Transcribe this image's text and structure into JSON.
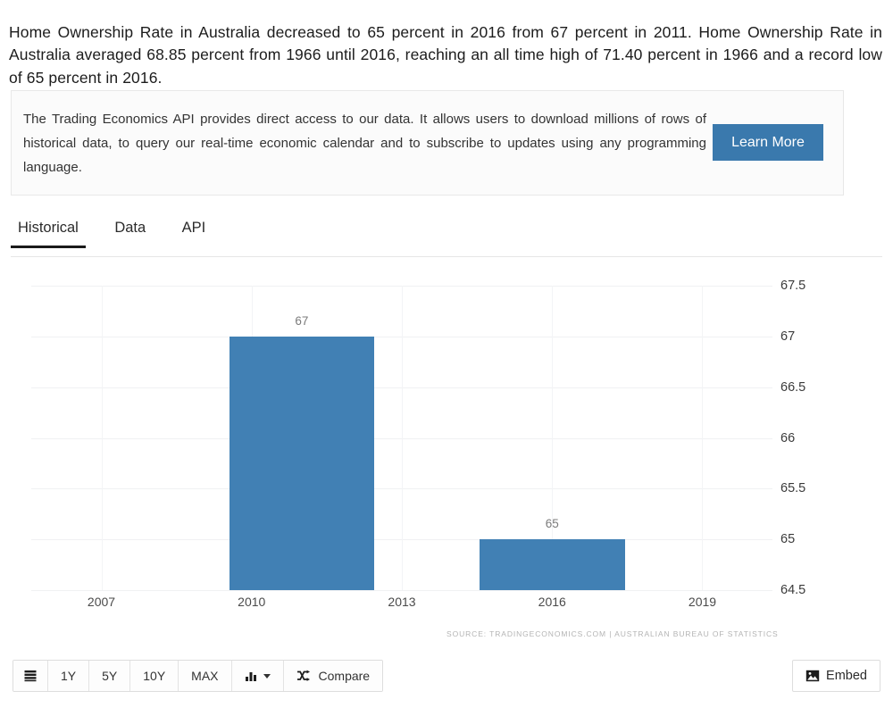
{
  "intro": {
    "paragraph": "Home Ownership Rate in Australia decreased to 65 percent in 2016 from 67 percent in 2011. Home Ownership Rate in Australia averaged 68.85 percent from 1966 until 2016, reaching an all time high of 71.40 percent in 1966 and a record low of 65 percent in 2016."
  },
  "api_banner": {
    "text": "The Trading Economics API provides direct access to our data. It allows users to download millions of rows of historical data, to query our real-time economic calendar and to subscribe to updates using any programming language.",
    "button_label": "Learn More",
    "button_color": "#3a79ad"
  },
  "tabs": [
    {
      "label": "Historical",
      "active": true
    },
    {
      "label": "Data",
      "active": false
    },
    {
      "label": "API",
      "active": false
    }
  ],
  "chart_data": {
    "type": "bar",
    "title": "",
    "xlabel": "",
    "ylabel": "",
    "categories": [
      "2011",
      "2016"
    ],
    "values": [
      67,
      65
    ],
    "bar_labels": [
      "67",
      "65"
    ],
    "series": [
      {
        "name": "Home Ownership Rate",
        "values": [
          67,
          65
        ]
      }
    ],
    "ylim": [
      64.5,
      67.5
    ],
    "yticks": [
      "67.5",
      "67",
      "66.5",
      "66",
      "65.5",
      "65",
      "64.5"
    ],
    "ytick_values": [
      67.5,
      67,
      66.5,
      66,
      65.5,
      65,
      64.5
    ],
    "xticks": [
      "2007",
      "2010",
      "2013",
      "2016",
      "2019"
    ],
    "xtick_values": [
      2007,
      2010,
      2013,
      2016,
      2019
    ],
    "xlim": [
      2005.6,
      2020.4
    ],
    "grid": true,
    "legend": "none",
    "bar_color": "#4180b4",
    "source": "SOURCE: TRADINGECONOMICS.COM  |  AUSTRALIAN BUREAU OF STATISTICS"
  },
  "toolbar": {
    "list_icon": "list-icon",
    "ranges": [
      "1Y",
      "5Y",
      "10Y",
      "MAX"
    ],
    "chart_type_icon": "bar-chart-icon",
    "compare_label": "Compare",
    "compare_icon": "shuffle-icon",
    "embed_label": "Embed",
    "embed_icon": "image-icon"
  }
}
